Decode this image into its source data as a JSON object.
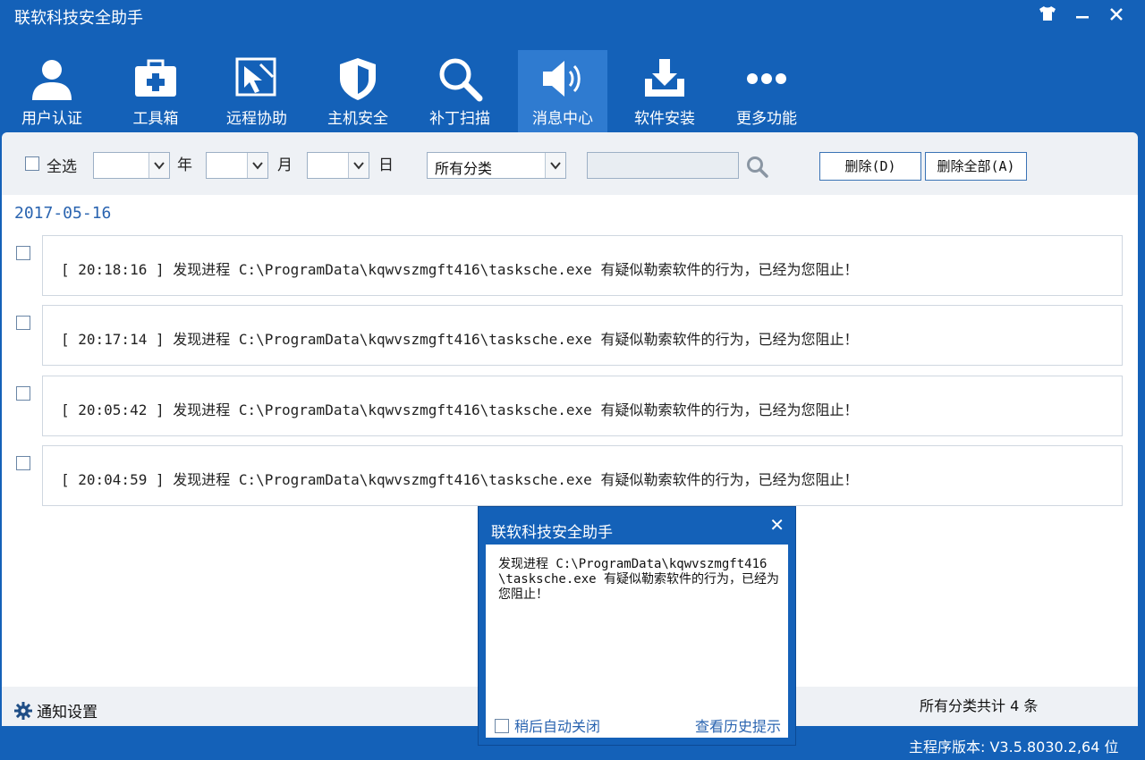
{
  "window": {
    "title": "联软科技安全助手"
  },
  "nav": {
    "items": [
      {
        "label": "用户认证",
        "icon": "user-icon"
      },
      {
        "label": "工具箱",
        "icon": "toolbox-icon"
      },
      {
        "label": "远程协助",
        "icon": "remote-assist-icon"
      },
      {
        "label": "主机安全",
        "icon": "shield-icon"
      },
      {
        "label": "补丁扫描",
        "icon": "magnifier-icon"
      },
      {
        "label": "消息中心",
        "icon": "speaker-icon",
        "active": true
      },
      {
        "label": "软件安装",
        "icon": "download-tray-icon"
      },
      {
        "label": "更多功能",
        "icon": "more-dots-icon"
      }
    ]
  },
  "toolbar": {
    "select_all_label": "全选",
    "year_label": "年",
    "month_label": "月",
    "day_label": "日",
    "year_value": "",
    "month_value": "",
    "day_value": "",
    "category_value": "所有分类",
    "search_value": "",
    "delete_label": "删除(D)",
    "delete_all_label": "删除全部(A)"
  },
  "messages": {
    "date": "2017-05-16",
    "items": [
      {
        "text": "[ 20:18:16 ] 发现进程 C:\\ProgramData\\kqwvszmgft416\\tasksche.exe 有疑似勒索软件的行为，已经为您阻止！"
      },
      {
        "text": "[ 20:17:14 ] 发现进程 C:\\ProgramData\\kqwvszmgft416\\tasksche.exe 有疑似勒索软件的行为，已经为您阻止！"
      },
      {
        "text": "[ 20:05:42 ] 发现进程 C:\\ProgramData\\kqwvszmgft416\\tasksche.exe 有疑似勒索软件的行为，已经为您阻止！"
      },
      {
        "text": "[ 20:04:59 ] 发现进程 C:\\ProgramData\\kqwvszmgft416\\tasksche.exe 有疑似勒索软件的行为，已经为您阻止！"
      }
    ]
  },
  "footer": {
    "settings_label": "通知设置",
    "count_text": "所有分类共计 4 条"
  },
  "status": {
    "version_text": "主程序版本: V3.5.8030.2,64 位"
  },
  "popup": {
    "title": "联软科技安全助手",
    "close_glyph": "✕",
    "text": "发现进程 C:\\ProgramData\\kqwvszmgft416\\tasksche.exe 有疑似勒索软件的行为，已经为您阻止！",
    "auto_close_label": "稍后自动关闭",
    "history_label": "查看历史提示"
  }
}
